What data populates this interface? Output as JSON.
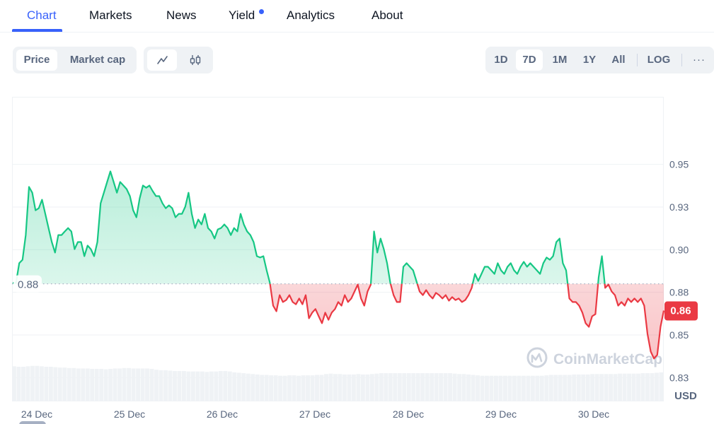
{
  "tabs": [
    {
      "label": "Chart",
      "active": true
    },
    {
      "label": "Markets",
      "active": false
    },
    {
      "label": "News",
      "active": false
    },
    {
      "label": "Yield",
      "active": false,
      "has_dot": true
    },
    {
      "label": "Analytics",
      "active": false
    },
    {
      "label": "About",
      "active": false
    }
  ],
  "metric_toggle": {
    "options": [
      "Price",
      "Market cap"
    ],
    "selected": "Price"
  },
  "chart_type_toggle": {
    "options": [
      {
        "icon": "line-chart-icon"
      },
      {
        "icon": "candlestick-icon"
      }
    ],
    "selected": "line-chart-icon"
  },
  "range_toggle": {
    "options": [
      "1D",
      "7D",
      "1M",
      "1Y",
      "All"
    ],
    "selected": "7D",
    "scale_label": "LOG",
    "more_label": "···"
  },
  "colors": {
    "accent": "#3861fb",
    "up": "#16c784",
    "down": "#ea3943",
    "axis_text": "#58667e",
    "grid": "#eff2f5"
  },
  "watermark": "CoinMarketCap",
  "chart_data": {
    "type": "line",
    "title": "",
    "xlabel": "",
    "ylabel": "USD",
    "currency_label": "USD",
    "x_tick_labels": [
      "24 Dec",
      "25 Dec",
      "26 Dec",
      "27 Dec",
      "28 Dec",
      "29 Dec",
      "30 Dec"
    ],
    "y_tick_labels": [
      "0.95",
      "0.93",
      "0.90",
      "0.88",
      "0.85",
      "0.83"
    ],
    "y_ticks": [
      0.95,
      0.925,
      0.9,
      0.875,
      0.85,
      0.825
    ],
    "ylim": [
      0.8115,
      0.9896
    ],
    "grid": true,
    "reference_price": 0.88,
    "reference_label": "0.88",
    "current_price": 0.8643,
    "current_label": "0.86",
    "price_series": [
      0.8805,
      0.8805,
      0.8921,
      0.8941,
      0.9086,
      0.9368,
      0.9334,
      0.9231,
      0.9243,
      0.9293,
      0.921,
      0.9127,
      0.9045,
      0.8983,
      0.9086,
      0.9086,
      0.9107,
      0.9127,
      0.9107,
      0.9003,
      0.9045,
      0.9045,
      0.8962,
      0.9024,
      0.9003,
      0.8962,
      0.9045,
      0.9272,
      0.9334,
      0.9397,
      0.9459,
      0.9397,
      0.9334,
      0.9397,
      0.9376,
      0.9355,
      0.9314,
      0.9231,
      0.919,
      0.9301,
      0.9376,
      0.9363,
      0.9376,
      0.9343,
      0.9314,
      0.9314,
      0.9272,
      0.9243,
      0.926,
      0.9243,
      0.919,
      0.921,
      0.921,
      0.9252,
      0.9334,
      0.921,
      0.9127,
      0.9177,
      0.9148,
      0.921,
      0.9127,
      0.9107,
      0.9065,
      0.9119,
      0.9127,
      0.9148,
      0.9127,
      0.9086,
      0.9127,
      0.9107,
      0.921,
      0.9148,
      0.9107,
      0.9086,
      0.9045,
      0.8962,
      0.8954,
      0.8962,
      0.8879,
      0.8805,
      0.8672,
      0.8639,
      0.8734,
      0.8693,
      0.8705,
      0.8734,
      0.8693,
      0.868,
      0.8714,
      0.868,
      0.8734,
      0.8598,
      0.8631,
      0.8652,
      0.861,
      0.8569,
      0.8631,
      0.8589,
      0.8631,
      0.8652,
      0.8693,
      0.8672,
      0.8734,
      0.8693,
      0.8714,
      0.8755,
      0.8796,
      0.8714,
      0.8672,
      0.8755,
      0.8796,
      0.9107,
      0.8983,
      0.9065,
      0.9003,
      0.8921,
      0.8805,
      0.8734,
      0.8693,
      0.8693,
      0.89,
      0.8921,
      0.89,
      0.8879,
      0.8817,
      0.8755,
      0.8734,
      0.8763,
      0.8734,
      0.8714,
      0.8747,
      0.8734,
      0.8714,
      0.8734,
      0.8701,
      0.8722,
      0.8705,
      0.8714,
      0.8693,
      0.8705,
      0.8734,
      0.8776,
      0.8858,
      0.8817,
      0.8858,
      0.89,
      0.89,
      0.8879,
      0.8858,
      0.8921,
      0.8879,
      0.8858,
      0.89,
      0.8921,
      0.8879,
      0.8858,
      0.89,
      0.8929,
      0.89,
      0.8921,
      0.89,
      0.8879,
      0.8858,
      0.8921,
      0.8954,
      0.8941,
      0.8962,
      0.9045,
      0.9065,
      0.8921,
      0.8879,
      0.8714,
      0.8693,
      0.8693,
      0.8672,
      0.8631,
      0.8569,
      0.8548,
      0.861,
      0.8622,
      0.8838,
      0.8962,
      0.8776,
      0.8796,
      0.8755,
      0.8734,
      0.8672,
      0.8693,
      0.8672,
      0.8714,
      0.8693,
      0.8714,
      0.8693,
      0.8714,
      0.8672,
      0.8507,
      0.8403,
      0.8362,
      0.8383,
      0.8548,
      0.8643
    ],
    "volume_series": [
      0.8,
      0.79,
      0.79,
      0.8,
      0.81,
      0.81,
      0.8,
      0.79,
      0.79,
      0.78,
      0.77,
      0.77,
      0.76,
      0.76,
      0.75,
      0.75,
      0.75,
      0.74,
      0.74,
      0.74,
      0.73,
      0.74,
      0.75,
      0.75,
      0.76,
      0.76,
      0.75,
      0.75,
      0.75,
      0.75,
      0.74,
      0.72,
      0.71,
      0.71,
      0.7,
      0.69,
      0.69,
      0.69,
      0.68,
      0.68,
      0.68,
      0.68,
      0.67,
      0.68,
      0.68,
      0.69,
      0.69,
      0.68,
      0.66,
      0.65,
      0.64,
      0.63,
      0.62,
      0.61,
      0.6,
      0.6,
      0.59,
      0.59,
      0.58,
      0.58,
      0.59,
      0.59,
      0.58,
      0.59,
      0.59,
      0.59,
      0.6,
      0.6,
      0.62,
      0.63,
      0.62,
      0.62,
      0.61,
      0.61,
      0.61,
      0.62,
      0.61,
      0.61,
      0.62,
      0.63,
      0.64,
      0.64,
      0.64,
      0.64,
      0.64,
      0.64,
      0.64,
      0.64,
      0.64,
      0.64,
      0.64,
      0.64,
      0.64,
      0.64,
      0.64,
      0.64,
      0.63,
      0.62,
      0.62,
      0.61,
      0.6,
      0.59,
      0.58,
      0.58,
      0.58,
      0.58,
      0.58,
      0.58,
      0.58,
      0.58,
      0.58,
      0.58,
      0.58,
      0.58,
      0.58,
      0.58,
      0.59,
      0.6,
      0.6,
      0.6,
      0.6,
      0.6,
      0.61,
      0.61,
      0.61,
      0.61,
      0.62,
      0.62,
      0.62,
      0.62,
      0.62,
      0.62,
      0.63,
      0.63,
      0.63,
      0.63,
      0.63,
      0.64,
      0.64,
      0.64,
      0.65,
      0.66
    ]
  }
}
